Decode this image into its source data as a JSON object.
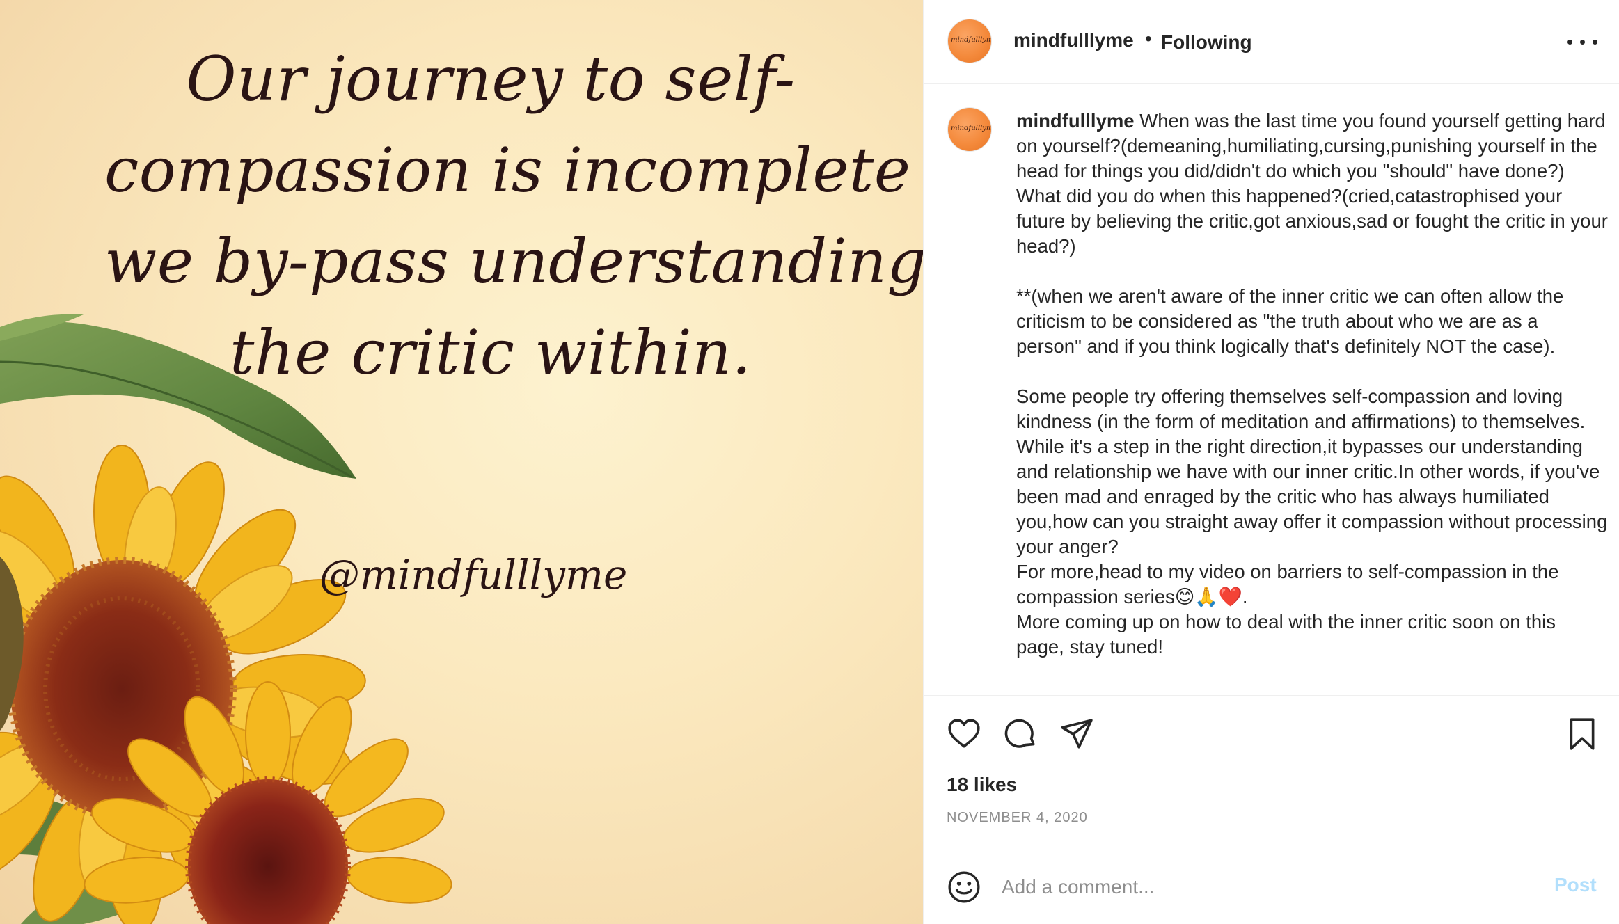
{
  "image": {
    "quote_lines": [
      "Our journey to self-",
      "compassion is incomplete if",
      "we by-pass understanding",
      "the critic within."
    ],
    "handle": "@mindfulllyme",
    "avatar_text": "mindfulllyme"
  },
  "header": {
    "username": "mindfulllyme",
    "separator": "•",
    "follow_status": "Following"
  },
  "caption": {
    "author": "mindfulllyme",
    "text": " When was the last time you found yourself getting hard on yourself?(demeaning,humiliating,cursing,punishing yourself in the head for things you did/didn't do which you \"should\" have done?)\nWhat did you do when this happened?(cried,catastrophised your future by believing the critic,got anxious,sad or fought the critic in your head?)\n\n**(when we aren't aware of the inner critic we can often allow the criticism to be considered as \"the truth about who we are as a person\" and if you think logically that's definitely NOT the case).\n\nSome people try offering themselves self-compassion and loving kindness (in the form of meditation and affirmations) to themselves. While it's a step in the right direction,it bypasses our understanding and relationship we have with our inner critic.In other words, if you've been mad and enraged by the critic who has always humiliated you,how can you straight away offer it compassion without processing your anger?\nFor more,head to my video on barriers to self-compassion in the compassion series😊🙏❤️.\nMore coming up on how to deal with the inner critic soon on this page, stay tuned!"
  },
  "actions": {
    "icons": [
      "heart-icon",
      "comment-icon",
      "share-icon",
      "bookmark-icon"
    ],
    "likes": "18 likes",
    "date": "NOVEMBER 4, 2020"
  },
  "comment": {
    "placeholder": "Add a comment...",
    "post_label": "Post"
  },
  "colors": {
    "accent_disabled": "#b2dffc",
    "text": "#262626",
    "muted": "#8e8e8e",
    "avatar": "#f48a3c"
  }
}
